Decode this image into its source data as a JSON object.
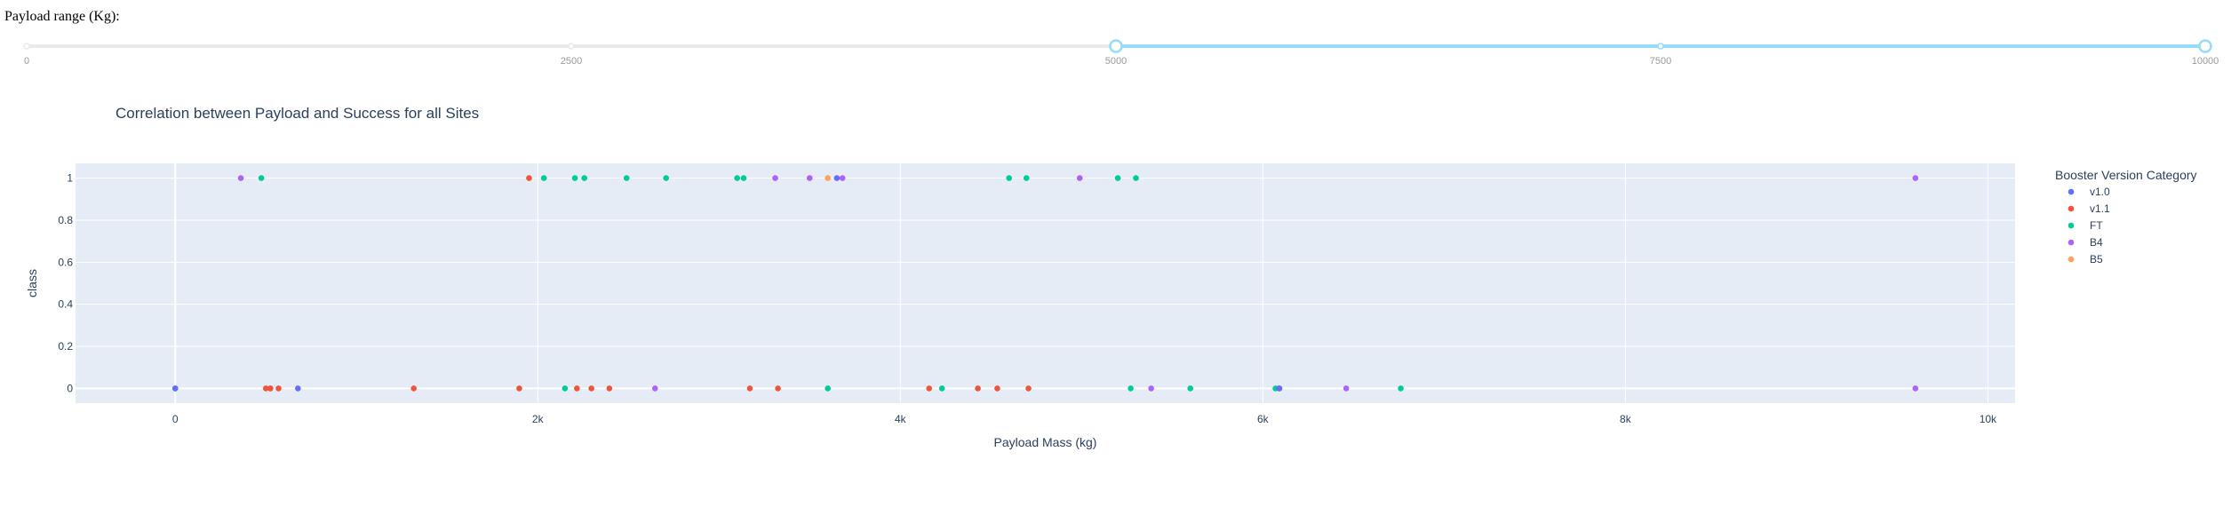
{
  "slider": {
    "label": "Payload range (Kg):",
    "min": 0,
    "max": 10000,
    "marks": [
      0,
      2500,
      5000,
      7500,
      10000
    ],
    "selected_range": [
      5000,
      10000
    ],
    "colors": {
      "track": "#e9e9e9",
      "active": "#96dbfa",
      "handle_border": "#96dbfa",
      "mark_text": "#999999"
    }
  },
  "chart_data": {
    "type": "scatter",
    "title": "Correlation between Payload and Success for all Sites",
    "xlabel": "Payload Mass (kg)",
    "ylabel": "class",
    "xlim": [
      -550,
      10150
    ],
    "ylim": [
      -0.07,
      1.07
    ],
    "x_ticks": [
      0,
      2000,
      4000,
      6000,
      8000,
      10000
    ],
    "x_tick_labels": [
      "0",
      "2k",
      "4k",
      "6k",
      "8k",
      "10k"
    ],
    "y_ticks": [
      0,
      0.2,
      0.4,
      0.6,
      0.8,
      1
    ],
    "y_tick_labels": [
      "0",
      "0.2",
      "0.4",
      "0.6",
      "0.8",
      "1"
    ],
    "grid": true,
    "legend_title": "Booster Version Category",
    "legend_position": "right",
    "plot_bgcolor": "#e5ecf6",
    "series": [
      {
        "name": "v1.0",
        "color": "#636efa",
        "x": [
          0,
          0,
          525,
          677
        ],
        "y": [
          0,
          0,
          0,
          0
        ]
      },
      {
        "name": "v1.1",
        "color": "#ef553b",
        "x": [
          500,
          525,
          570,
          1316,
          1898,
          1952,
          2216,
          2296,
          2395,
          3170,
          3325,
          4159,
          4428,
          4535,
          4707
        ],
        "y": [
          0,
          0,
          0,
          0,
          0,
          1,
          0,
          0,
          0,
          0,
          0,
          0,
          0,
          0,
          0
        ]
      },
      {
        "name": "FT",
        "color": "#00cc96",
        "x": [
          475,
          2034,
          2150,
          2205,
          2257,
          2490,
          2708,
          3100,
          3136,
          3600,
          4230,
          4600,
          4696,
          5200,
          5271,
          5300,
          5600,
          6070,
          6761
        ],
        "y": [
          1,
          1,
          0,
          1,
          1,
          1,
          1,
          1,
          1,
          0,
          0,
          1,
          1,
          1,
          0,
          1,
          0,
          0,
          0
        ]
      },
      {
        "name": "B4",
        "color": "#ab63fa",
        "x": [
          362,
          2647,
          3310,
          3500,
          3681,
          4990,
          5384,
          6092,
          6460,
          9600,
          9600
        ],
        "y": [
          1,
          0,
          1,
          1,
          1,
          1,
          0,
          0,
          0,
          1,
          0
        ]
      },
      {
        "name": "B5",
        "color": "#ffa15a",
        "x": [
          3600
        ],
        "y": [
          1
        ]
      }
    ],
    "extra_points": [
      {
        "series": "v1.0",
        "x": 3650,
        "y": 1
      },
      {
        "series": "v1.0",
        "x": 6090,
        "y": 0
      }
    ]
  }
}
